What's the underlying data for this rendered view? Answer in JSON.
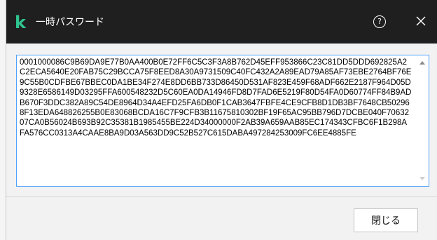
{
  "window": {
    "title": "一時パスワード",
    "logo_glyph": "k",
    "help_glyph": "?",
    "accent_color": "#2ec38f",
    "titlebar_color": "#1f1f1f"
  },
  "textarea": {
    "value": "0001000086C9B69DA9E77B0AA400B0E72FF6C5C3F3A8B762D45EFF953866C23C81DD5DDD692825A2C2ECA5640E20FAB75C29BCCA75F8EED8A30A9731509C40FC432A2A89EAD79A85AF73EBE2764BF76E9C55B0CDFBE67BBEC0DA1BE34F274E8DD6BB733D86450D531AF823E459F68ADF662E2187F964D05D9328E6586149D03295FFA600548232D5C60EA0DA14946FD8D7FAD6E5219F80D54FA0D60774FF84B9ADB670F3DDC382A89C54DE8964D34A4EFD25FA6DB0F1CAB3647FBFE4CE9CFB8D1DB3BF7648CB502968F13EDA648826255B0E83068BCDA16C7F9CFB3B11675810302BF19F65AC95BB796D7DCBE040F7063207CA0B56024B693B92C35381B1985455BE224D34000000F2AB39A659AAB85EC174343CFBC6F1B298AFA576CC0313A4CAAE8BA9D03A563DD9C52B527C615DABA497284253009FC6EE4885FE"
  },
  "footer": {
    "close_label": "閉じる"
  }
}
